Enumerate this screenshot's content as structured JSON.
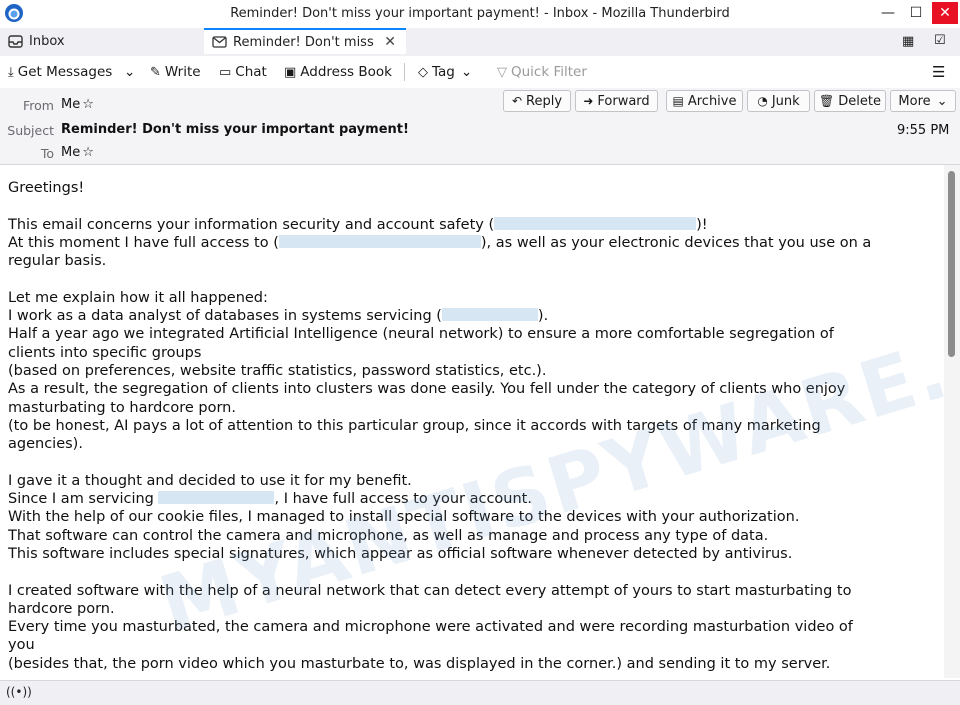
{
  "window": {
    "title": "Reminder! Don't miss your important payment! - Inbox - Mozilla Thunderbird",
    "minimize": "—",
    "maximize": "☐",
    "close": "✕"
  },
  "tabs": [
    {
      "label": "Inbox",
      "icon": "inbox-icon"
    },
    {
      "label": "Reminder! Don't miss",
      "icon": "mail-icon",
      "active": true
    }
  ],
  "toolbar": {
    "get_messages": "Get Messages",
    "write": "Write",
    "chat": "Chat",
    "address_book": "Address Book",
    "tag": "Tag",
    "quick_filter": "Quick Filter"
  },
  "message_header": {
    "from_label": "From",
    "from_value": "Me",
    "subject_label": "Subject",
    "subject_value": "Reminder! Don't miss your important payment!",
    "to_label": "To",
    "to_value": "Me",
    "time": "9:55 PM",
    "actions": {
      "reply": "Reply",
      "forward": "Forward",
      "archive": "Archive",
      "junk": "Junk",
      "delete": "Delete",
      "more": "More"
    }
  },
  "body": {
    "greeting": "Greetings!",
    "p1a": "This email concerns your information security and account safety (",
    "p1b": ")!",
    "p2a": "At this moment I have full access to (",
    "p2b": "), as well as your electronic devices that you use on a",
    "p2c": "regular basis.",
    "p3": "Let me explain how it all happened:",
    "p4a": "I work as a data analyst of databases in systems servicing (",
    "p4b": ").",
    "p5a": "Half a year ago we integrated Artificial Intelligence (neural network) to ensure a more comfortable segregation of",
    "p5b": "clients into specific groups",
    "p6": "(based on preferences, website traffic statistics, password statistics, etc.).",
    "p7a": "As a result, the segregation of clients into clusters was done easily. You fell under the category of clients who enjoy",
    "p7b": "masturbating to hardcore porn.",
    "p8a": "(to be honest, AI pays a lot of attention to this particular group, since it accords with targets of many marketing",
    "p8b": "agencies).",
    "p9": "I gave it a thought and decided to use it for my benefit.",
    "p10a": "Since I am servicing",
    "p10b": ", I have full access to your account.",
    "p11": "With the help of our cookie files, I managed to install special software to the devices with your authorization.",
    "p12": "That software can control the camera and microphone, as well as manage and process any type of data.",
    "p13": "This software includes special signatures, which appear as official software whenever detected by antivirus.",
    "p14a": "I created software with the help of a neural network that can detect every attempt of yours to start masturbating to",
    "p14b": "hardcore porn.",
    "p15a": "Every time you masturbated, the camera and microphone were activated and were recording masturbation video of",
    "p15b": "you",
    "p16": "(besides that, the porn video which you masturbate to, was displayed in the corner.) and sending it to my server."
  },
  "watermark": "MYANTISPYWARE.COM"
}
